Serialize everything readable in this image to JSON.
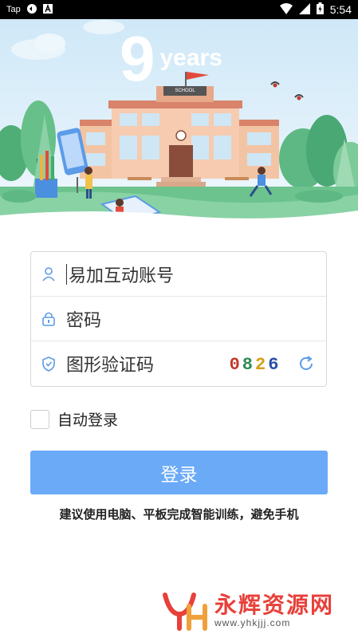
{
  "status_bar": {
    "left_label": "Tap",
    "time": "5:54"
  },
  "hero": {
    "big_number": "9",
    "years_text": "years",
    "school_sign": "SCHOOL"
  },
  "form": {
    "account_placeholder": "易加互动账号",
    "password_placeholder": "密码",
    "captcha_placeholder": "图形验证码",
    "captcha_chars": [
      "0",
      "8",
      "2",
      "6"
    ],
    "captcha_colors": [
      "#c0392b",
      "#2e8b57",
      "#d4a017",
      "#2b4fa8"
    ]
  },
  "auto_login": {
    "label": "自动登录",
    "checked": false
  },
  "login_button": {
    "label": "登录",
    "color": "#6aaaf7"
  },
  "tip": "建议使用电脑、平板完成智能训练，避免手机",
  "watermark": {
    "logo_text": "YH",
    "title": "永辉资源网",
    "url": "www.yhkjjj.com"
  }
}
